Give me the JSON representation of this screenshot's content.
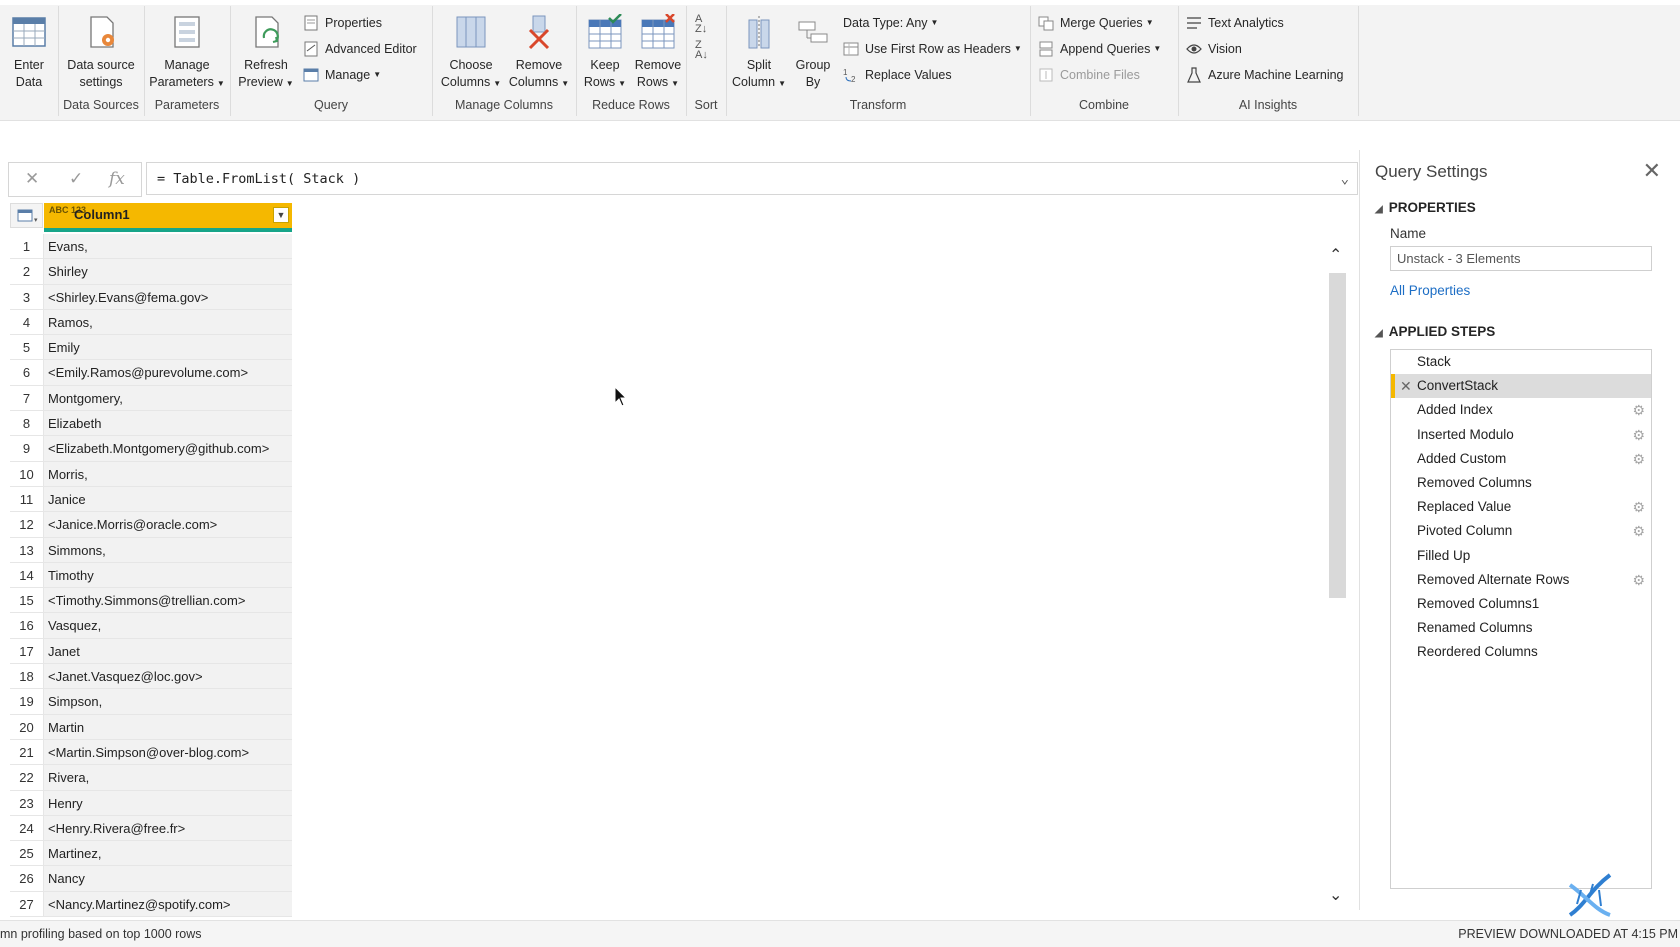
{
  "ribbon": {
    "groups": {
      "data_sources": "Data Sources",
      "parameters": "Parameters",
      "query": "Query",
      "manage_columns": "Manage Columns",
      "reduce_rows": "Reduce Rows",
      "sort": "Sort",
      "transform": "Transform",
      "combine": "Combine",
      "ai_insights": "AI Insights"
    },
    "enter_data": [
      "Enter",
      "Data"
    ],
    "data_source_settings": [
      "Data source",
      "settings"
    ],
    "manage_parameters": [
      "Manage",
      "Parameters"
    ],
    "refresh_preview": [
      "Refresh",
      "Preview"
    ],
    "properties": "Properties",
    "advanced_editor": "Advanced Editor",
    "manage": "Manage",
    "choose_columns": [
      "Choose",
      "Columns"
    ],
    "remove_columns": [
      "Remove",
      "Columns"
    ],
    "keep_rows": [
      "Keep",
      "Rows"
    ],
    "remove_rows": [
      "Remove",
      "Rows"
    ],
    "split_column": [
      "Split",
      "Column"
    ],
    "group_by": [
      "Group",
      "By"
    ],
    "data_type": "Data Type: Any",
    "use_first_row": "Use First Row as Headers",
    "replace_values": "Replace Values",
    "merge_queries": "Merge Queries",
    "append_queries": "Append Queries",
    "combine_files": "Combine Files",
    "text_analytics": "Text Analytics",
    "vision": "Vision",
    "azure_ml": "Azure Machine Learning"
  },
  "formula": {
    "text": "= Table.FromList( Stack )"
  },
  "grid": {
    "column_header": "Column1",
    "type_icon": "ABC 123",
    "rows": [
      {
        "n": "1",
        "v": "Evans,"
      },
      {
        "n": "2",
        "v": "Shirley"
      },
      {
        "n": "3",
        "v": "<Shirley.Evans@fema.gov>"
      },
      {
        "n": "4",
        "v": "Ramos,"
      },
      {
        "n": "5",
        "v": "Emily"
      },
      {
        "n": "6",
        "v": "<Emily.Ramos@purevolume.com>"
      },
      {
        "n": "7",
        "v": "Montgomery,"
      },
      {
        "n": "8",
        "v": "Elizabeth"
      },
      {
        "n": "9",
        "v": "<Elizabeth.Montgomery@github.com>"
      },
      {
        "n": "10",
        "v": "Morris,"
      },
      {
        "n": "11",
        "v": "Janice"
      },
      {
        "n": "12",
        "v": "<Janice.Morris@oracle.com>"
      },
      {
        "n": "13",
        "v": "Simmons,"
      },
      {
        "n": "14",
        "v": "Timothy"
      },
      {
        "n": "15",
        "v": "<Timothy.Simmons@trellian.com>"
      },
      {
        "n": "16",
        "v": "Vasquez,"
      },
      {
        "n": "17",
        "v": "Janet"
      },
      {
        "n": "18",
        "v": "<Janet.Vasquez@loc.gov>"
      },
      {
        "n": "19",
        "v": "Simpson,"
      },
      {
        "n": "20",
        "v": "Martin"
      },
      {
        "n": "21",
        "v": "<Martin.Simpson@over-blog.com>"
      },
      {
        "n": "22",
        "v": "Rivera,"
      },
      {
        "n": "23",
        "v": "Henry"
      },
      {
        "n": "24",
        "v": "<Henry.Rivera@free.fr>"
      },
      {
        "n": "25",
        "v": "Martinez,"
      },
      {
        "n": "26",
        "v": "Nancy"
      },
      {
        "n": "27",
        "v": "<Nancy.Martinez@spotify.com>"
      }
    ]
  },
  "query_settings": {
    "title": "Query Settings",
    "properties_header": "PROPERTIES",
    "name_label": "Name",
    "name_value": "Unstack - 3 Elements",
    "all_properties": "All Properties",
    "applied_steps_header": "APPLIED STEPS",
    "steps": [
      {
        "label": "Stack",
        "gear": false,
        "x": false,
        "selected": false
      },
      {
        "label": "ConvertStack",
        "gear": false,
        "x": true,
        "selected": true
      },
      {
        "label": "Added Index",
        "gear": true,
        "x": false,
        "selected": false
      },
      {
        "label": "Inserted Modulo",
        "gear": true,
        "x": false,
        "selected": false
      },
      {
        "label": "Added Custom",
        "gear": true,
        "x": false,
        "selected": false
      },
      {
        "label": "Removed Columns",
        "gear": false,
        "x": false,
        "selected": false
      },
      {
        "label": "Replaced Value",
        "gear": true,
        "x": false,
        "selected": false
      },
      {
        "label": "Pivoted Column",
        "gear": true,
        "x": false,
        "selected": false
      },
      {
        "label": "Filled Up",
        "gear": false,
        "x": false,
        "selected": false
      },
      {
        "label": "Removed Alternate Rows",
        "gear": true,
        "x": false,
        "selected": false
      },
      {
        "label": "Removed Columns1",
        "gear": false,
        "x": false,
        "selected": false
      },
      {
        "label": "Renamed Columns",
        "gear": false,
        "x": false,
        "selected": false
      },
      {
        "label": "Reordered Columns",
        "gear": false,
        "x": false,
        "selected": false
      }
    ]
  },
  "status": {
    "left": "mn profiling based on top 1000 rows",
    "right": "PREVIEW DOWNLOADED AT 4:15 PM"
  },
  "colors": {
    "accent": "#f5b800",
    "header_underline": "#17a589",
    "link": "#1d6ec5"
  }
}
